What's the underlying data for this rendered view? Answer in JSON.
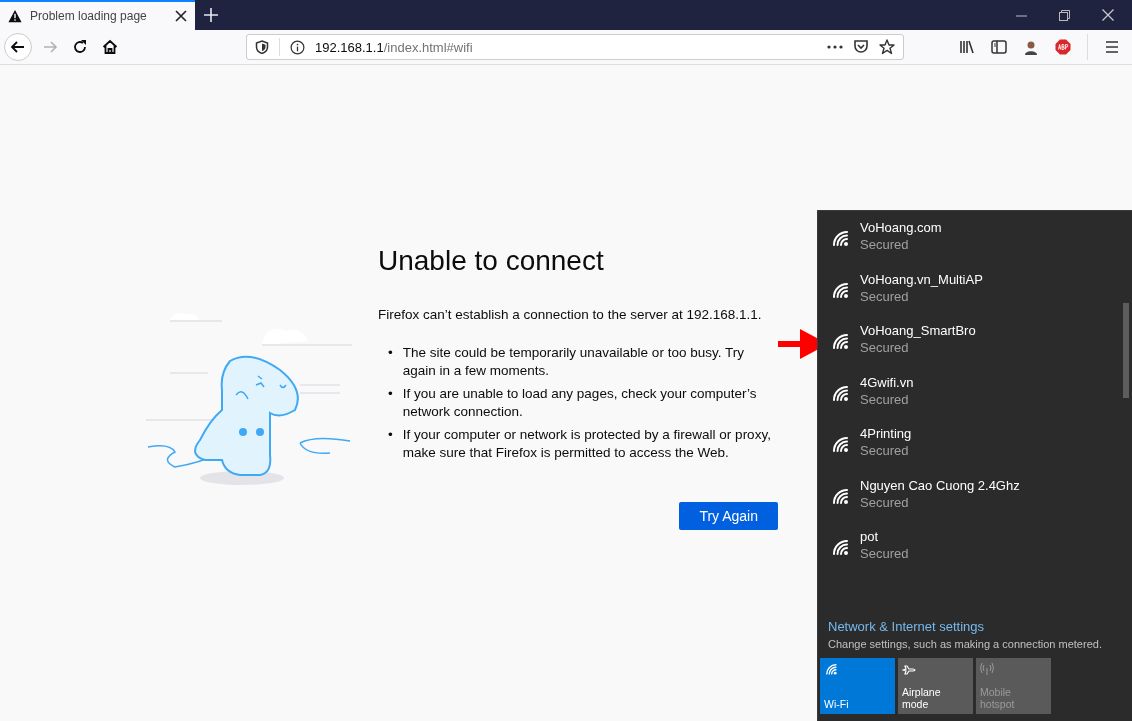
{
  "tab": {
    "title": "Problem loading page",
    "selected": true
  },
  "navigation": {
    "back_enabled": true,
    "forward_enabled": false
  },
  "address_bar": {
    "host": "192.168.1.1",
    "path": "/index.html#wifi"
  },
  "error_page": {
    "title": "Unable to connect",
    "message": "Firefox can’t establish a connection to the server at 192.168.1.1.",
    "bullets": [
      {
        "marker": "•",
        "text": "The site could be temporarily unavailable or too busy. Try again in a few moments."
      },
      {
        "marker": "•",
        "text": "If you are unable to load any pages, check your computer’s network connection."
      },
      {
        "marker": "•",
        "text": "If your computer or network is protected by a firewall or proxy, make sure that Firefox is permitted to access the Web."
      }
    ],
    "button": "Try Again"
  },
  "wifi_flyout": {
    "networks": [
      {
        "name": "VoHoang.com",
        "status": "Secured"
      },
      {
        "name": "VoHoang.vn_MultiAP",
        "status": "Secured"
      },
      {
        "name": "VoHoang_SmartBro",
        "status": "Secured"
      },
      {
        "name": "4Gwifi.vn",
        "status": "Secured"
      },
      {
        "name": "4Printing",
        "status": "Secured"
      },
      {
        "name": "Nguyen Cao Cuong 2.4Ghz",
        "status": "Secured"
      },
      {
        "name": "pot",
        "status": "Secured"
      }
    ],
    "settings_link": "Network & Internet settings",
    "settings_description": "Change settings, such as making a connection metered.",
    "quick_actions": [
      {
        "kind": "wifi",
        "label": "Wi-Fi",
        "on": true,
        "disabled": false
      },
      {
        "kind": "airplane",
        "label": "Airplane mode",
        "on": false,
        "disabled": false
      },
      {
        "kind": "hotspot",
        "label": "Mobile hotspot",
        "on": false,
        "disabled": true
      }
    ]
  }
}
